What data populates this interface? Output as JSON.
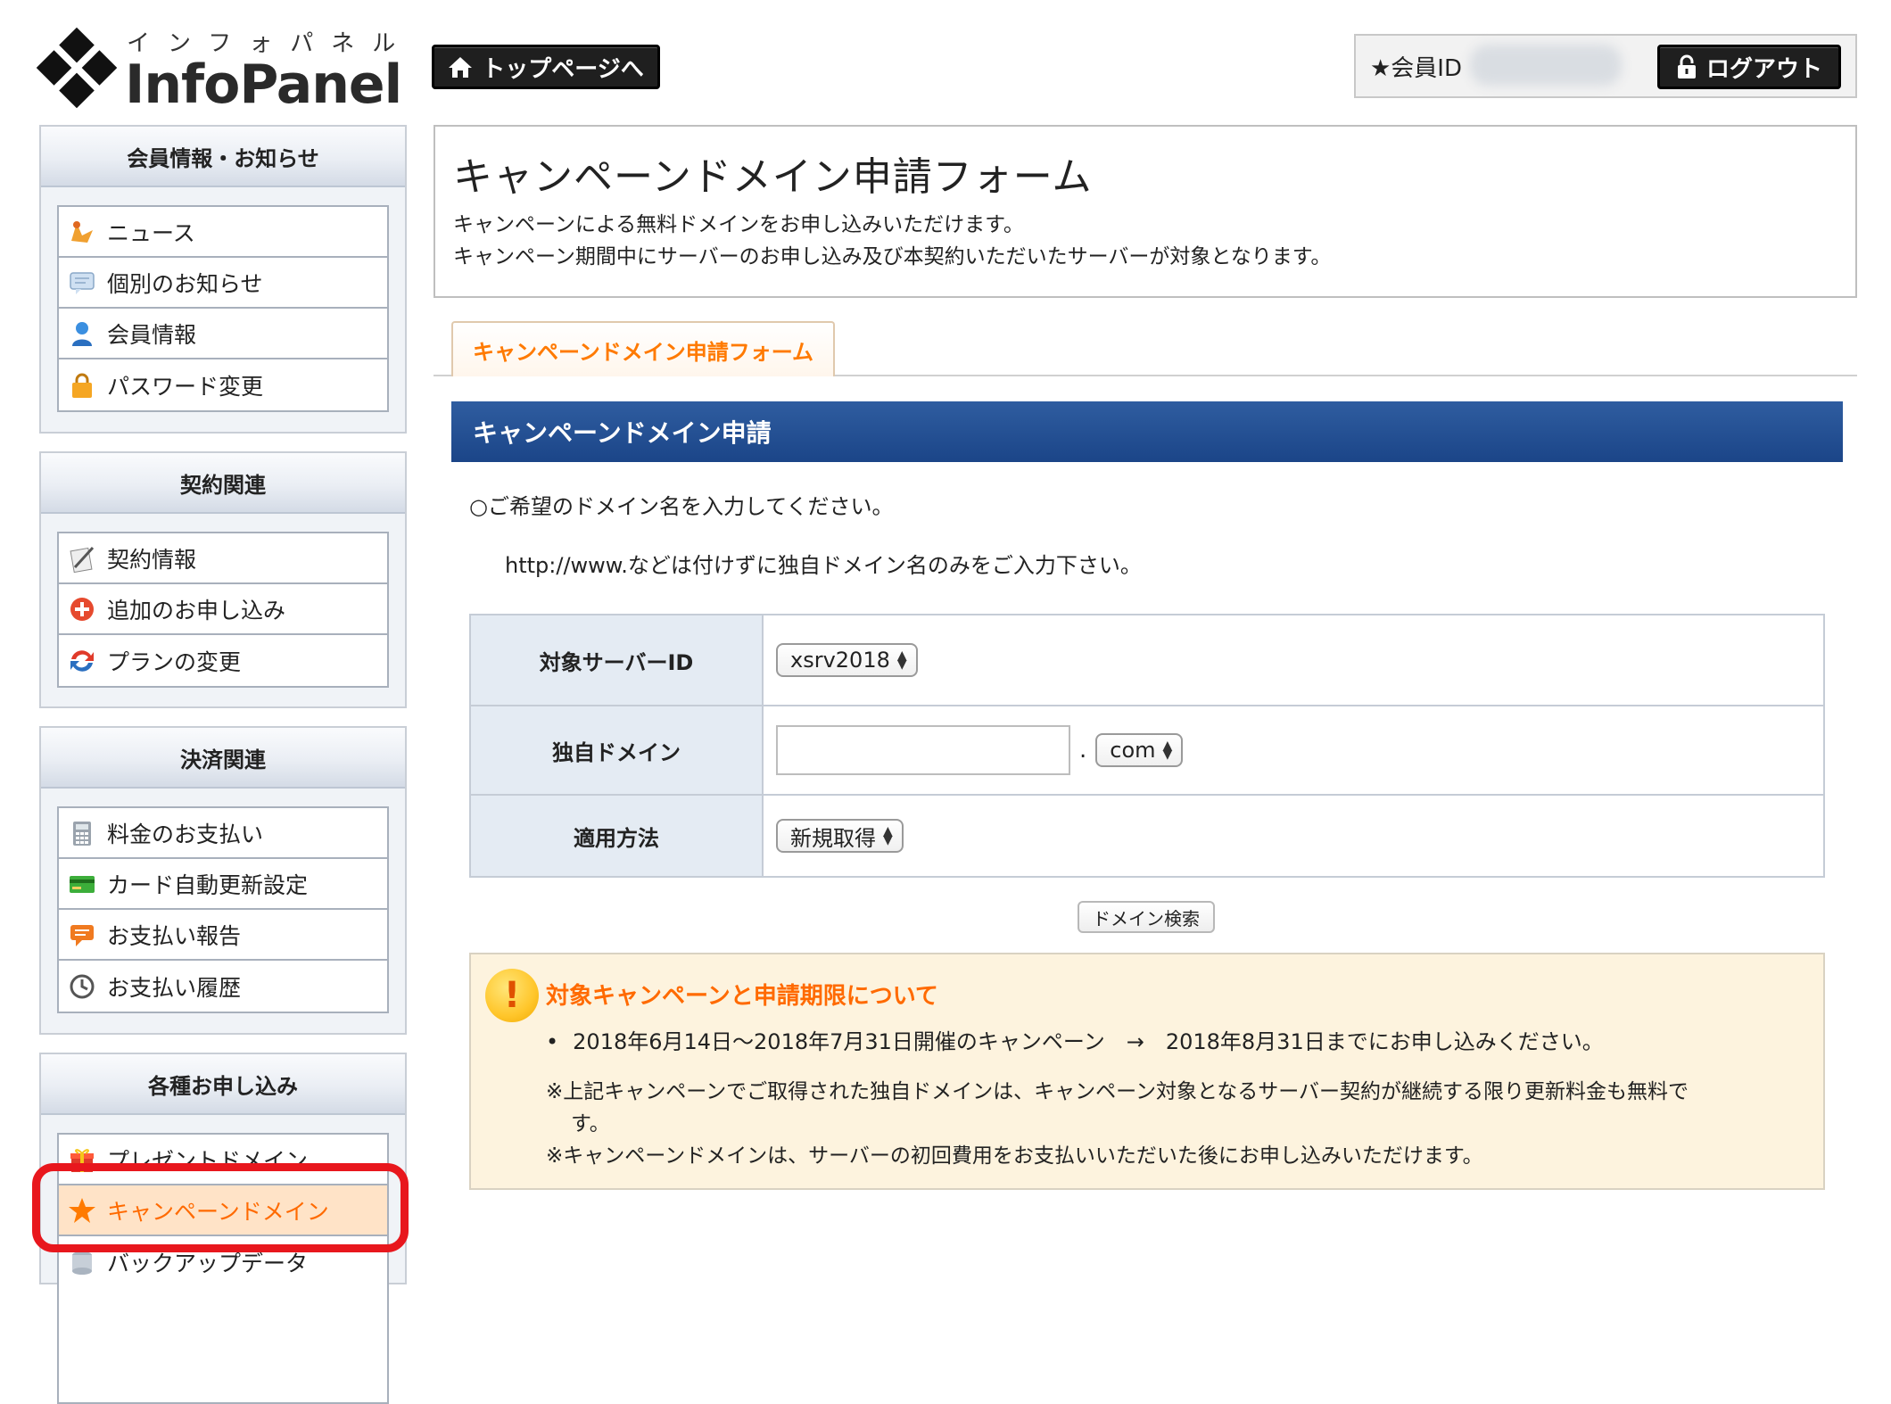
{
  "logo": {
    "kana": "インフォパネル",
    "name": "InfoPanel"
  },
  "header": {
    "top_page_label": "トップページへ",
    "member_id_label": "★会員ID",
    "logout_label": "ログアウト"
  },
  "sidebar": {
    "sections": [
      {
        "title": "会員情報・お知らせ",
        "items": [
          {
            "label": "ニュース",
            "icon": "news-icon"
          },
          {
            "label": "個別のお知らせ",
            "icon": "message-icon"
          },
          {
            "label": "会員情報",
            "icon": "user-icon"
          },
          {
            "label": "パスワード変更",
            "icon": "lock-icon"
          }
        ]
      },
      {
        "title": "契約関連",
        "items": [
          {
            "label": "契約情報",
            "icon": "contract-icon"
          },
          {
            "label": "追加のお申し込み",
            "icon": "add-icon"
          },
          {
            "label": "プランの変更",
            "icon": "change-icon"
          }
        ]
      },
      {
        "title": "決済関連",
        "items": [
          {
            "label": "料金のお支払い",
            "icon": "calculator-icon"
          },
          {
            "label": "カード自動更新設定",
            "icon": "card-icon"
          },
          {
            "label": "お支払い報告",
            "icon": "report-icon"
          },
          {
            "label": "お支払い履歴",
            "icon": "clock-icon"
          }
        ]
      },
      {
        "title": "各種お申し込み",
        "items": [
          {
            "label": "プレゼントドメイン",
            "icon": "gift-icon"
          },
          {
            "label": "キャンペーンドメイン",
            "icon": "star-icon",
            "active": true
          },
          {
            "label": "バックアップデータ",
            "icon": "backup-icon"
          }
        ]
      }
    ]
  },
  "main": {
    "title": "キャンペーンドメイン申請フォーム",
    "description_1": "キャンペーンによる無料ドメインをお申し込みいただけます。",
    "description_2": "キャンペーン期間中にサーバーのお申し込み及び本契約いただいたサーバーが対象となります。",
    "tab_label": "キャンペーンドメイン申請フォーム",
    "section_title": "キャンペーンドメイン申請",
    "instruction": "○ご希望のドメイン名を入力してください。",
    "note": "http://www.などは付けずに独自ドメイン名のみをご入力下さい。",
    "form": {
      "server_id_label": "対象サーバーID",
      "server_id_value": "xsrv2018",
      "domain_label": "独自ドメイン",
      "domain_value": "",
      "domain_dot": ".",
      "tld_value": "com",
      "method_label": "適用方法",
      "method_value": "新規取得"
    },
    "search_button": "ドメイン検索",
    "notice": {
      "title": "対象キャンペーンと申請期限について",
      "bullet": "2018年6月14日〜2018年7月31日開催のキャンペーン　→　2018年8月31日までにお申し込みください。",
      "line1": "※上記キャンペーンでご取得された独自ドメインは、キャンペーン対象となるサーバー契約が継続する限り更新料金も無料で",
      "line1_cont": "す。",
      "line2": "※キャンペーンドメインは、サーバーの初回費用をお支払いいただいた後にお申し込みいただけます。"
    }
  },
  "colors": {
    "accent": "#ff6a00",
    "header_blue": "#1b4588",
    "highlight_red": "#e8171d"
  }
}
